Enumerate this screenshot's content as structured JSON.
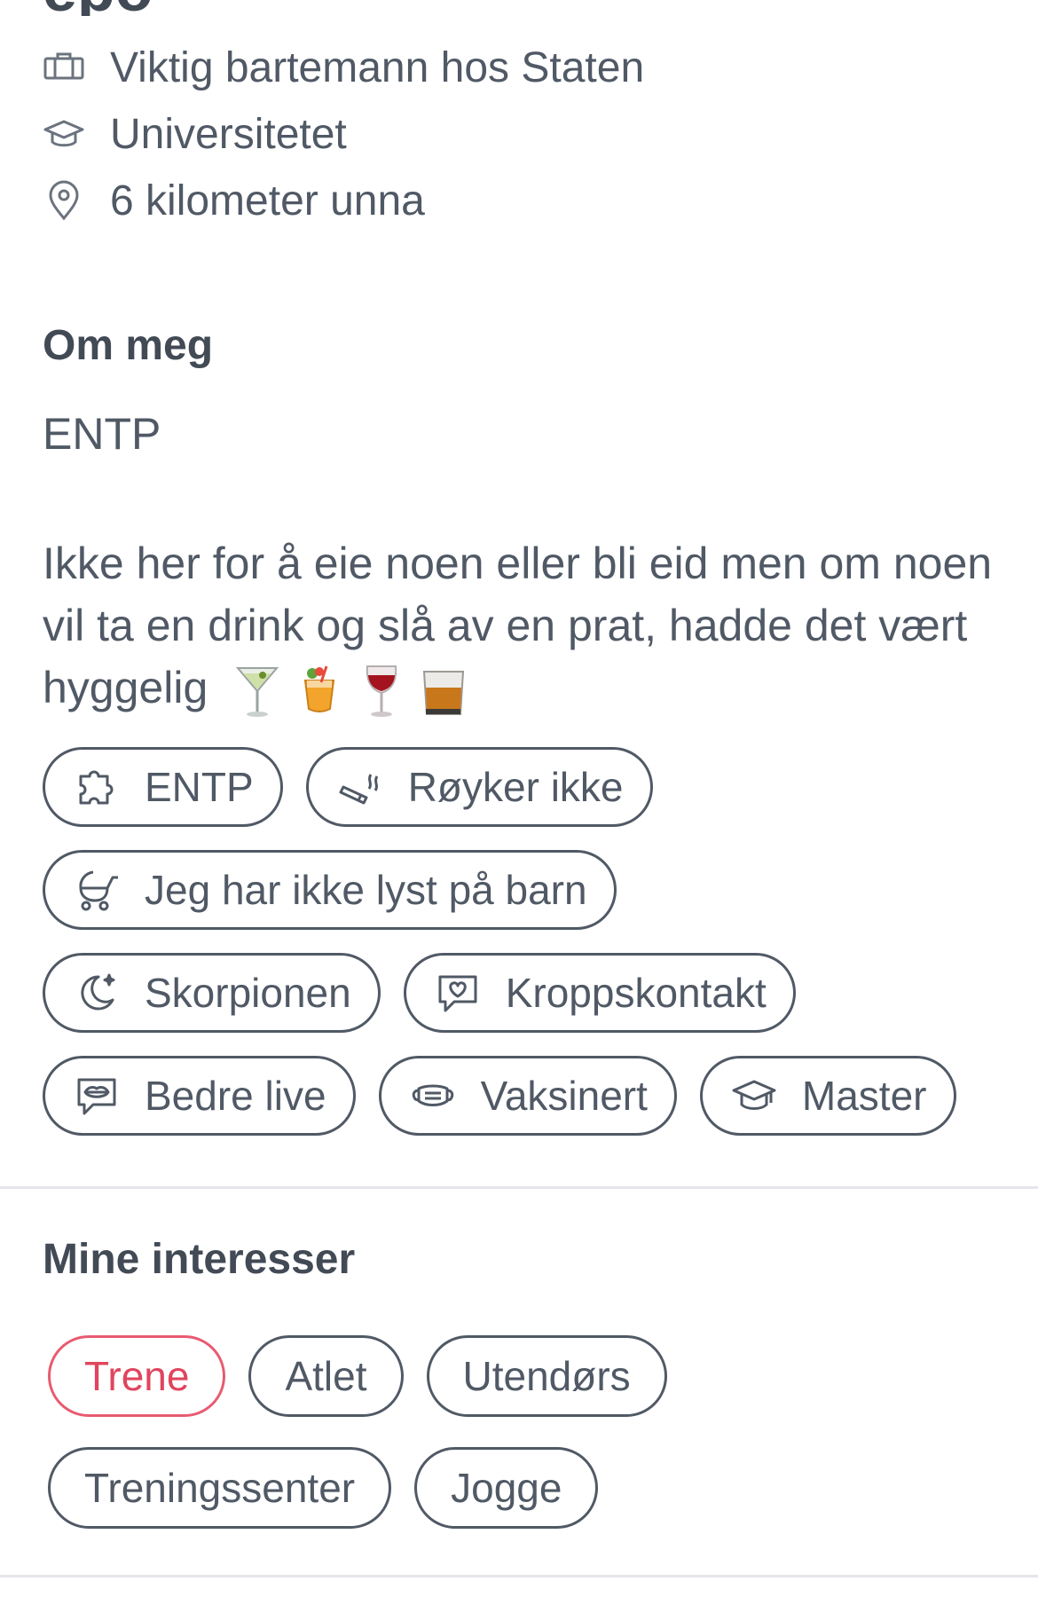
{
  "profile": {
    "name_cut": "epo",
    "job": "Viktig bartemann hos Staten",
    "school": "Universitetet",
    "distance": "6 kilometer unna"
  },
  "about": {
    "heading": "Om meg",
    "short": "ENTP",
    "bio": "Ikke her for å eie noen eller bli eid men om noen vil ta en drink og slå av en prat, hadde det vært hyggelig"
  },
  "emojis": [
    "cocktail-glass",
    "tropical-drink",
    "wine-glass",
    "tumbler-glass"
  ],
  "chips": [
    {
      "label": "ENTP",
      "icon": "puzzle-icon"
    },
    {
      "label": "Røyker ikke",
      "icon": "cigarette-icon"
    },
    {
      "label": "Jeg har ikke lyst på barn",
      "icon": "stroller-icon"
    },
    {
      "label": "Skorpionen",
      "icon": "moon-star-icon"
    },
    {
      "label": "Kroppskontakt",
      "icon": "heart-chat-icon"
    },
    {
      "label": "Bedre live",
      "icon": "lips-chat-icon"
    },
    {
      "label": "Vaksinert",
      "icon": "mask-icon"
    },
    {
      "label": "Master",
      "icon": "graduation-cap-icon"
    }
  ],
  "interests": {
    "heading": "Mine interesser",
    "items": [
      {
        "label": "Trene",
        "active": true
      },
      {
        "label": "Atlet",
        "active": false
      },
      {
        "label": "Utendørs",
        "active": false
      },
      {
        "label": "Treningssenter",
        "active": false
      },
      {
        "label": "Jogge",
        "active": false
      }
    ]
  },
  "colors": {
    "text": "#505965",
    "heading": "#424a55",
    "accent": "#e0455e",
    "divider": "#e4e6ea"
  }
}
